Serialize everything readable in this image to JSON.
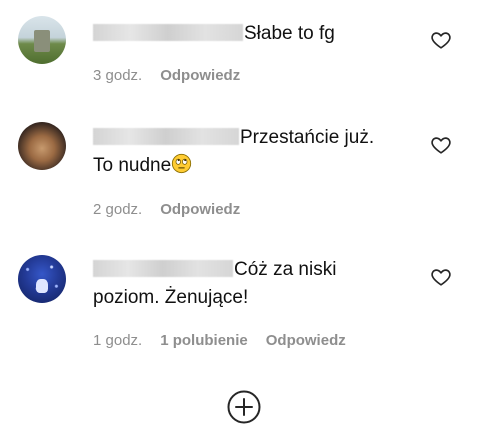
{
  "comments": [
    {
      "text_line1": "Słabe to fg",
      "time": "3 godz.",
      "reply_label": "Odpowiedz",
      "icons": {
        "avatar": "avatar-landscape",
        "like": "heart-outline-icon"
      }
    },
    {
      "text_line1": "Przestańcie już.",
      "text_line2": "To nudne",
      "emoji": "face-with-rolling-eyes",
      "time": "2 godz.",
      "reply_label": "Odpowiedz",
      "icons": {
        "avatar": "avatar-portrait",
        "like": "heart-outline-icon"
      }
    },
    {
      "text_line1": "Cóż za niski",
      "text_line2": "poziom. Żenujące!",
      "time": "1 godz.",
      "likes_label": "1 polubienie",
      "reply_label": "Odpowiedz",
      "icons": {
        "avatar": "avatar-starry-night",
        "like": "heart-outline-icon"
      }
    }
  ],
  "load_more": {
    "icon": "plus-circle-icon"
  },
  "colors": {
    "text": "#111111",
    "meta": "#8e8e8e",
    "background": "#ffffff"
  }
}
